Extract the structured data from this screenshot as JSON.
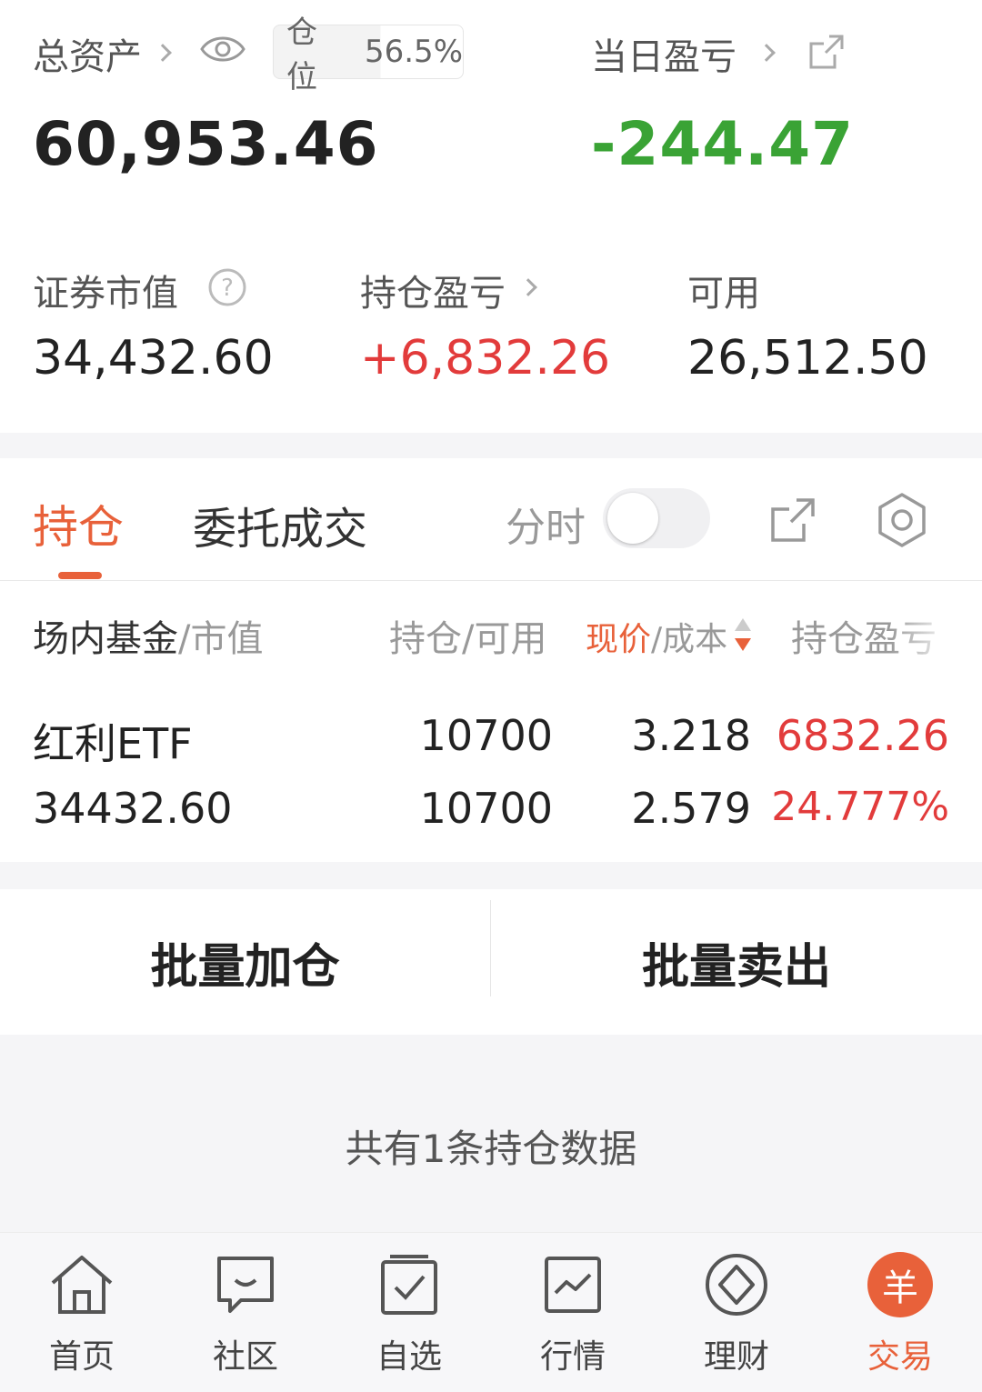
{
  "summary": {
    "total_assets_label": "总资产",
    "position_label": "仓位",
    "position_pct": "56.5%",
    "position_fraction": 0.565,
    "daily_pnl_label": "当日盈亏",
    "total_assets_value": "60,953.46",
    "daily_pnl_value": "-244.47",
    "securities_value_label": "证券市值",
    "holding_pnl_label": "持仓盈亏",
    "available_label": "可用",
    "securities_value": "34,432.60",
    "holding_pnl_value": "+6,832.26",
    "available_value": "26,512.50"
  },
  "tabs": {
    "holdings": "持仓",
    "orders": "委托成交",
    "timeshare_label": "分时",
    "timeshare_on": false
  },
  "table": {
    "col1_main": "场内基金",
    "col1_sub": "/市值",
    "col2": "持仓/可用",
    "col3_main": "现价",
    "col3_sub": "/成本",
    "col4": "持仓盈亏",
    "rows": [
      {
        "name": "红利ETF",
        "market_value": "34432.60",
        "holding": "10700",
        "available": "10700",
        "price": "3.218",
        "cost": "2.579",
        "pnl": "6832.26",
        "pnl_pct": "24.777%"
      }
    ]
  },
  "actions": {
    "batch_add": "批量加仓",
    "batch_sell": "批量卖出"
  },
  "footer_note": "共有1条持仓数据",
  "nav": {
    "home": "首页",
    "community": "社区",
    "watchlist": "自选",
    "market": "行情",
    "wealth": "理财",
    "trade": "交易",
    "trade_icon_glyph": "羊"
  },
  "colors": {
    "accent": "#e8613a",
    "up_red": "#e23b3b",
    "down_green": "#3aa335"
  }
}
